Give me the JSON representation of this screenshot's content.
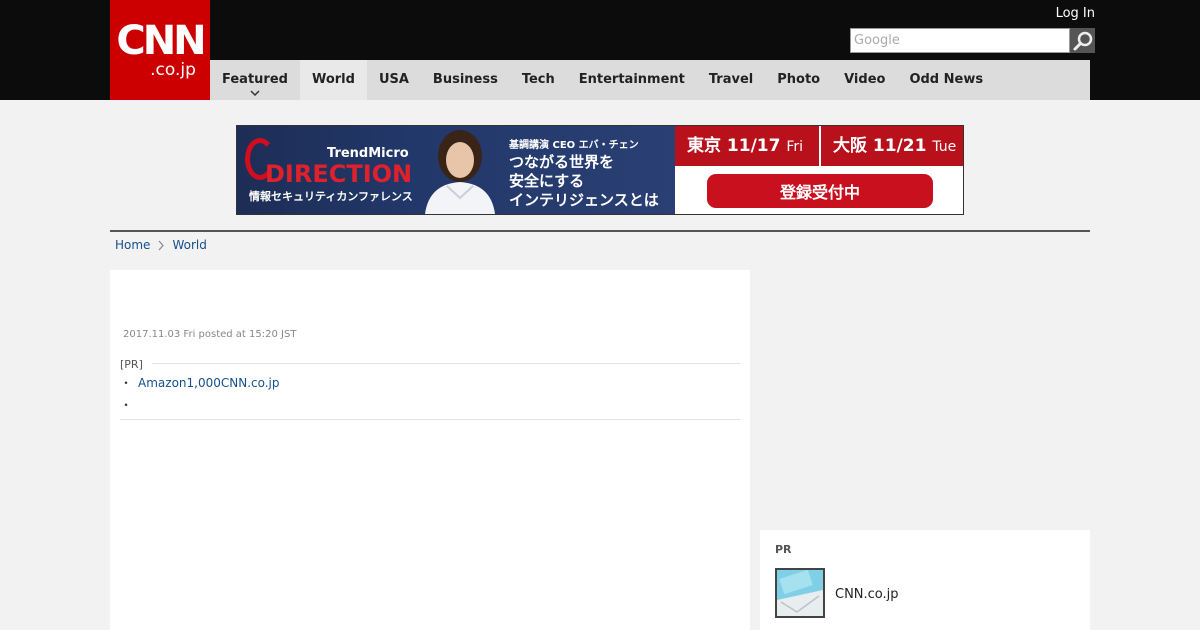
{
  "header": {
    "logo_main": "CNN",
    "logo_sub": ".co.jp",
    "login_label": "Log In",
    "search_placeholder": "Google"
  },
  "nav": {
    "items": [
      {
        "label": "Featured",
        "has_dropdown": true
      },
      {
        "label": "World",
        "active": true
      },
      {
        "label": "USA"
      },
      {
        "label": "Business"
      },
      {
        "label": "Tech"
      },
      {
        "label": "Entertainment"
      },
      {
        "label": "Travel"
      },
      {
        "label": "Photo"
      },
      {
        "label": "Video"
      },
      {
        "label": "Odd News"
      }
    ]
  },
  "banner": {
    "brand": "TrendMicro",
    "headline": "DIRECTION",
    "conference": "情報セキュリティカンファレンス",
    "speaker": "基調講演 CEO エバ・チェン",
    "tagline": "つながる世界を\n安全にする\nインテリジェンスとは",
    "date1_city": "東京",
    "date1_day": "11/17",
    "date1_dow": "Fri",
    "date2_city": "大阪",
    "date2_day": "11/21",
    "date2_dow": "Tue",
    "cta": "登録受付中"
  },
  "breadcrumb": {
    "home": "Home",
    "section": "World"
  },
  "article": {
    "posted": "2017.11.03 Fri posted at 15:20 JST",
    "pr_label": "[PR]",
    "pr_links": [
      {
        "bullet": "・",
        "text": "Amazon1,000CNN.co.jp"
      },
      {
        "bullet": "・",
        "text": ""
      }
    ]
  },
  "sidebar": {
    "pr_label": "PR",
    "item_label": "CNN.co.jp"
  },
  "colors": {
    "brand_red": "#cc0000",
    "header_black": "#0c0c0c",
    "nav_gray": "#dcdcdc",
    "link_blue": "#16508a"
  }
}
